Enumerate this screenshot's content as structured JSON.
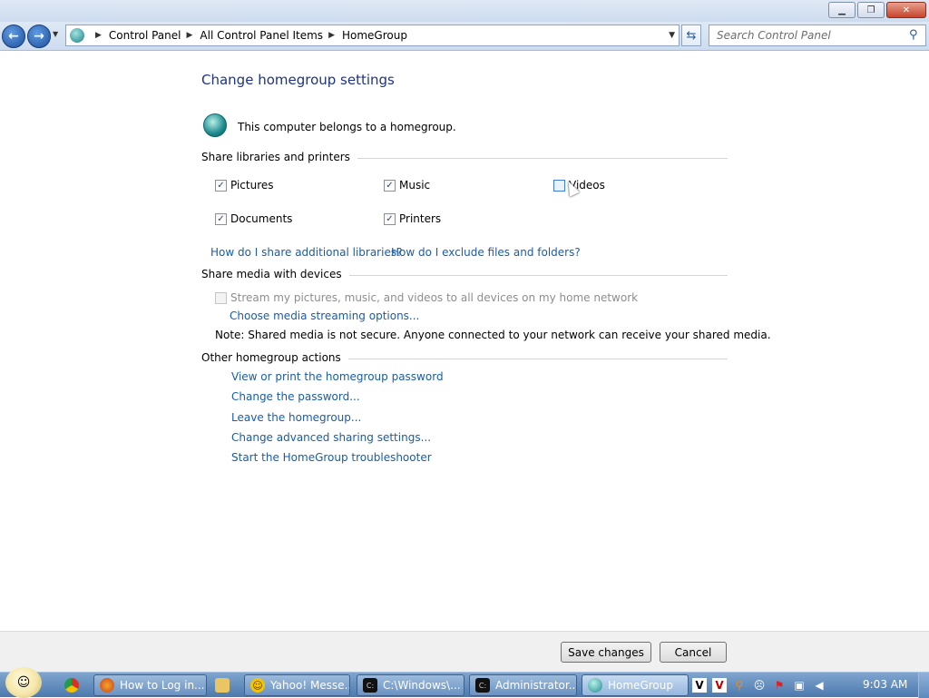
{
  "nav": {
    "breadcrumbs": [
      "Control Panel",
      "All Control Panel Items",
      "HomeGroup"
    ],
    "search_placeholder": "Search Control Panel"
  },
  "page": {
    "title": "Change homegroup settings",
    "membership_text": "This computer belongs to a homegroup.",
    "share_section": {
      "heading": "Share libraries and printers",
      "items": [
        {
          "label": "Pictures",
          "checked": true
        },
        {
          "label": "Music",
          "checked": true
        },
        {
          "label": "Videos",
          "checked": false
        },
        {
          "label": "Documents",
          "checked": true
        },
        {
          "label": "Printers",
          "checked": true
        }
      ],
      "links": [
        "How do I share additional libraries?",
        "How do I exclude files and folders?"
      ]
    },
    "media_section": {
      "heading": "Share media with devices",
      "stream_label": "Stream my pictures, music, and videos to all devices on my home network",
      "stream_checked": false,
      "streaming_link": "Choose media streaming options...",
      "note": "Note: Shared media is not secure. Anyone connected to your network can receive your shared media."
    },
    "actions_section": {
      "heading": "Other homegroup actions",
      "links": [
        "View or print the homegroup password",
        "Change the password...",
        "Leave the homegroup...",
        "Change advanced sharing settings...",
        "Start the HomeGroup troubleshooter"
      ]
    }
  },
  "footer": {
    "save_label": "Save changes",
    "cancel_label": "Cancel"
  },
  "taskbar": {
    "buttons": [
      {
        "label": "How to Log in...",
        "icon": "firefox-icon"
      },
      {
        "label": "Yahoo! Messe...",
        "icon": "yahoo-messenger-icon"
      },
      {
        "label": "C:\\Windows\\...",
        "icon": "cmd-icon"
      },
      {
        "label": "Administrator...",
        "icon": "cmd-icon"
      },
      {
        "label": "HomeGroup",
        "icon": "homegroup-icon"
      }
    ],
    "clock": "9:03 AM"
  }
}
